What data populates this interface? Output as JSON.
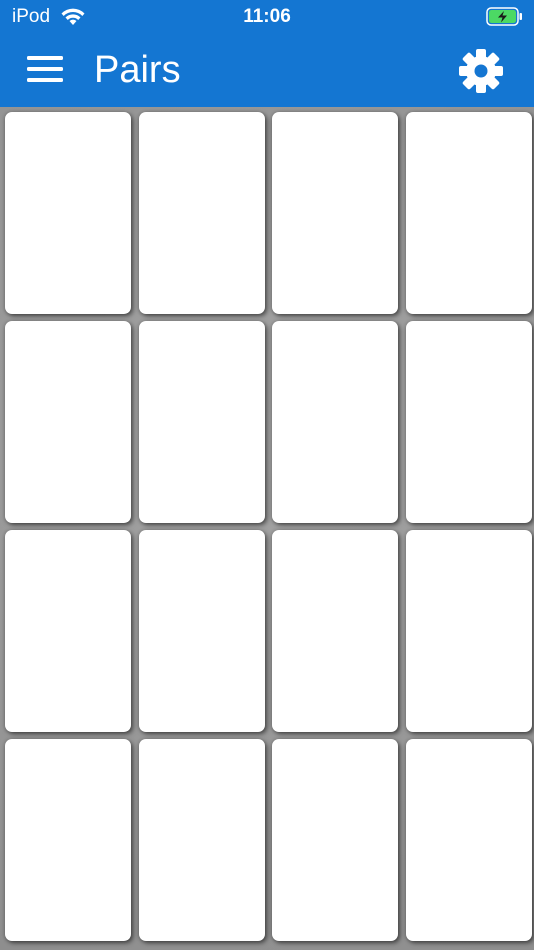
{
  "status_bar": {
    "carrier": "iPod",
    "time": "11:06",
    "wifi_icon": "wifi-icon",
    "battery_icon": "battery-charging-icon"
  },
  "nav": {
    "title": "Pairs",
    "menu_icon": "hamburger-menu-icon",
    "settings_icon": "gear-icon"
  },
  "colors": {
    "header_bg": "#1476d2",
    "board_bg": "#9a9a9a",
    "card_face": "#ffffff",
    "battery_fill": "#4cd964"
  },
  "board": {
    "rows": 4,
    "columns": 4,
    "card_state": "face-down",
    "card_count": 16
  }
}
